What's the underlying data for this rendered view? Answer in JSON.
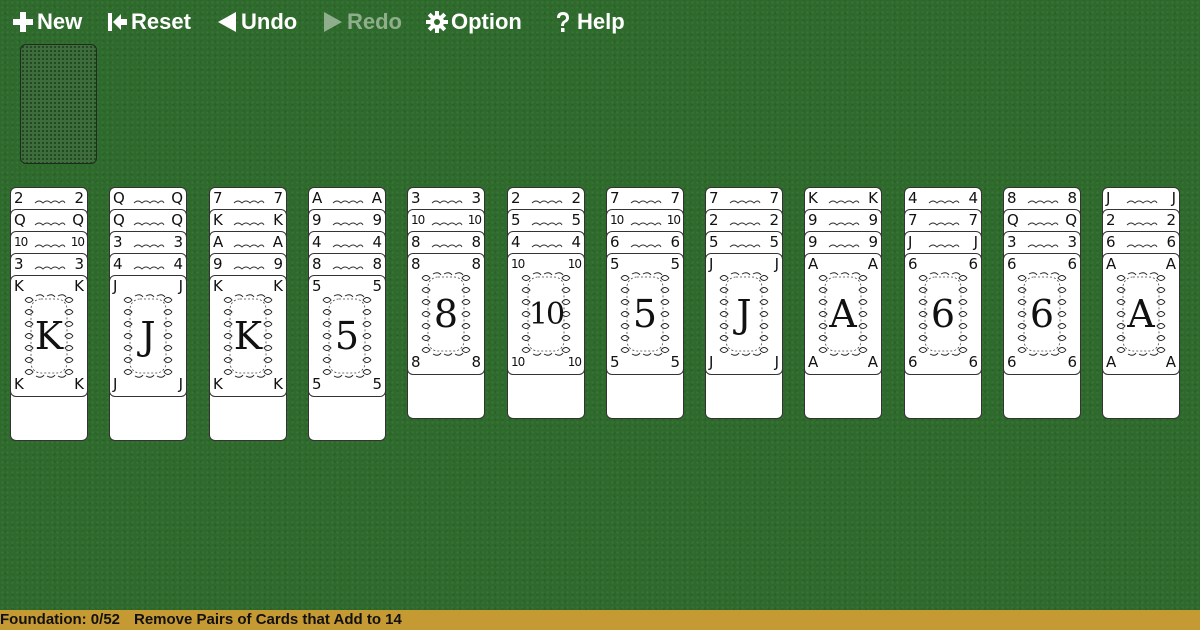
{
  "toolbar": {
    "new_label": "New",
    "reset_label": "Reset",
    "undo_label": "Undo",
    "redo_label": "Redo",
    "option_label": "Option",
    "help_label": "Help"
  },
  "colors": {
    "table_felt": "#2e6a2c",
    "status_bar": "#c69a33",
    "toolbar_text": "#ffffff",
    "toolbar_disabled_text": "#8fae8c"
  },
  "icons": {
    "new": "plus-icon",
    "reset": "skip-back-icon",
    "undo": "triangle-left-icon",
    "redo": "triangle-right-icon",
    "option": "gear-icon",
    "help": "question-icon"
  },
  "stock": {
    "face_down": true
  },
  "tableau": [
    {
      "cards": [
        "2",
        "Q",
        "10",
        "3",
        "K"
      ]
    },
    {
      "cards": [
        "Q",
        "Q",
        "3",
        "4",
        "J"
      ]
    },
    {
      "cards": [
        "7",
        "K",
        "A",
        "9",
        "K"
      ]
    },
    {
      "cards": [
        "A",
        "9",
        "4",
        "8",
        "5"
      ]
    },
    {
      "cards": [
        "3",
        "10",
        "8",
        "8"
      ]
    },
    {
      "cards": [
        "2",
        "5",
        "4",
        "10"
      ]
    },
    {
      "cards": [
        "7",
        "10",
        "6",
        "5"
      ]
    },
    {
      "cards": [
        "7",
        "2",
        "5",
        "J"
      ]
    },
    {
      "cards": [
        "K",
        "9",
        "9",
        "A"
      ]
    },
    {
      "cards": [
        "4",
        "7",
        "J",
        "6"
      ]
    },
    {
      "cards": [
        "8",
        "Q",
        "3",
        "6"
      ]
    },
    {
      "cards": [
        "J",
        "2",
        "6",
        "A"
      ]
    }
  ],
  "status": {
    "foundation": "Foundation: 0/52",
    "message": "Remove Pairs of Cards that Add to 14"
  }
}
